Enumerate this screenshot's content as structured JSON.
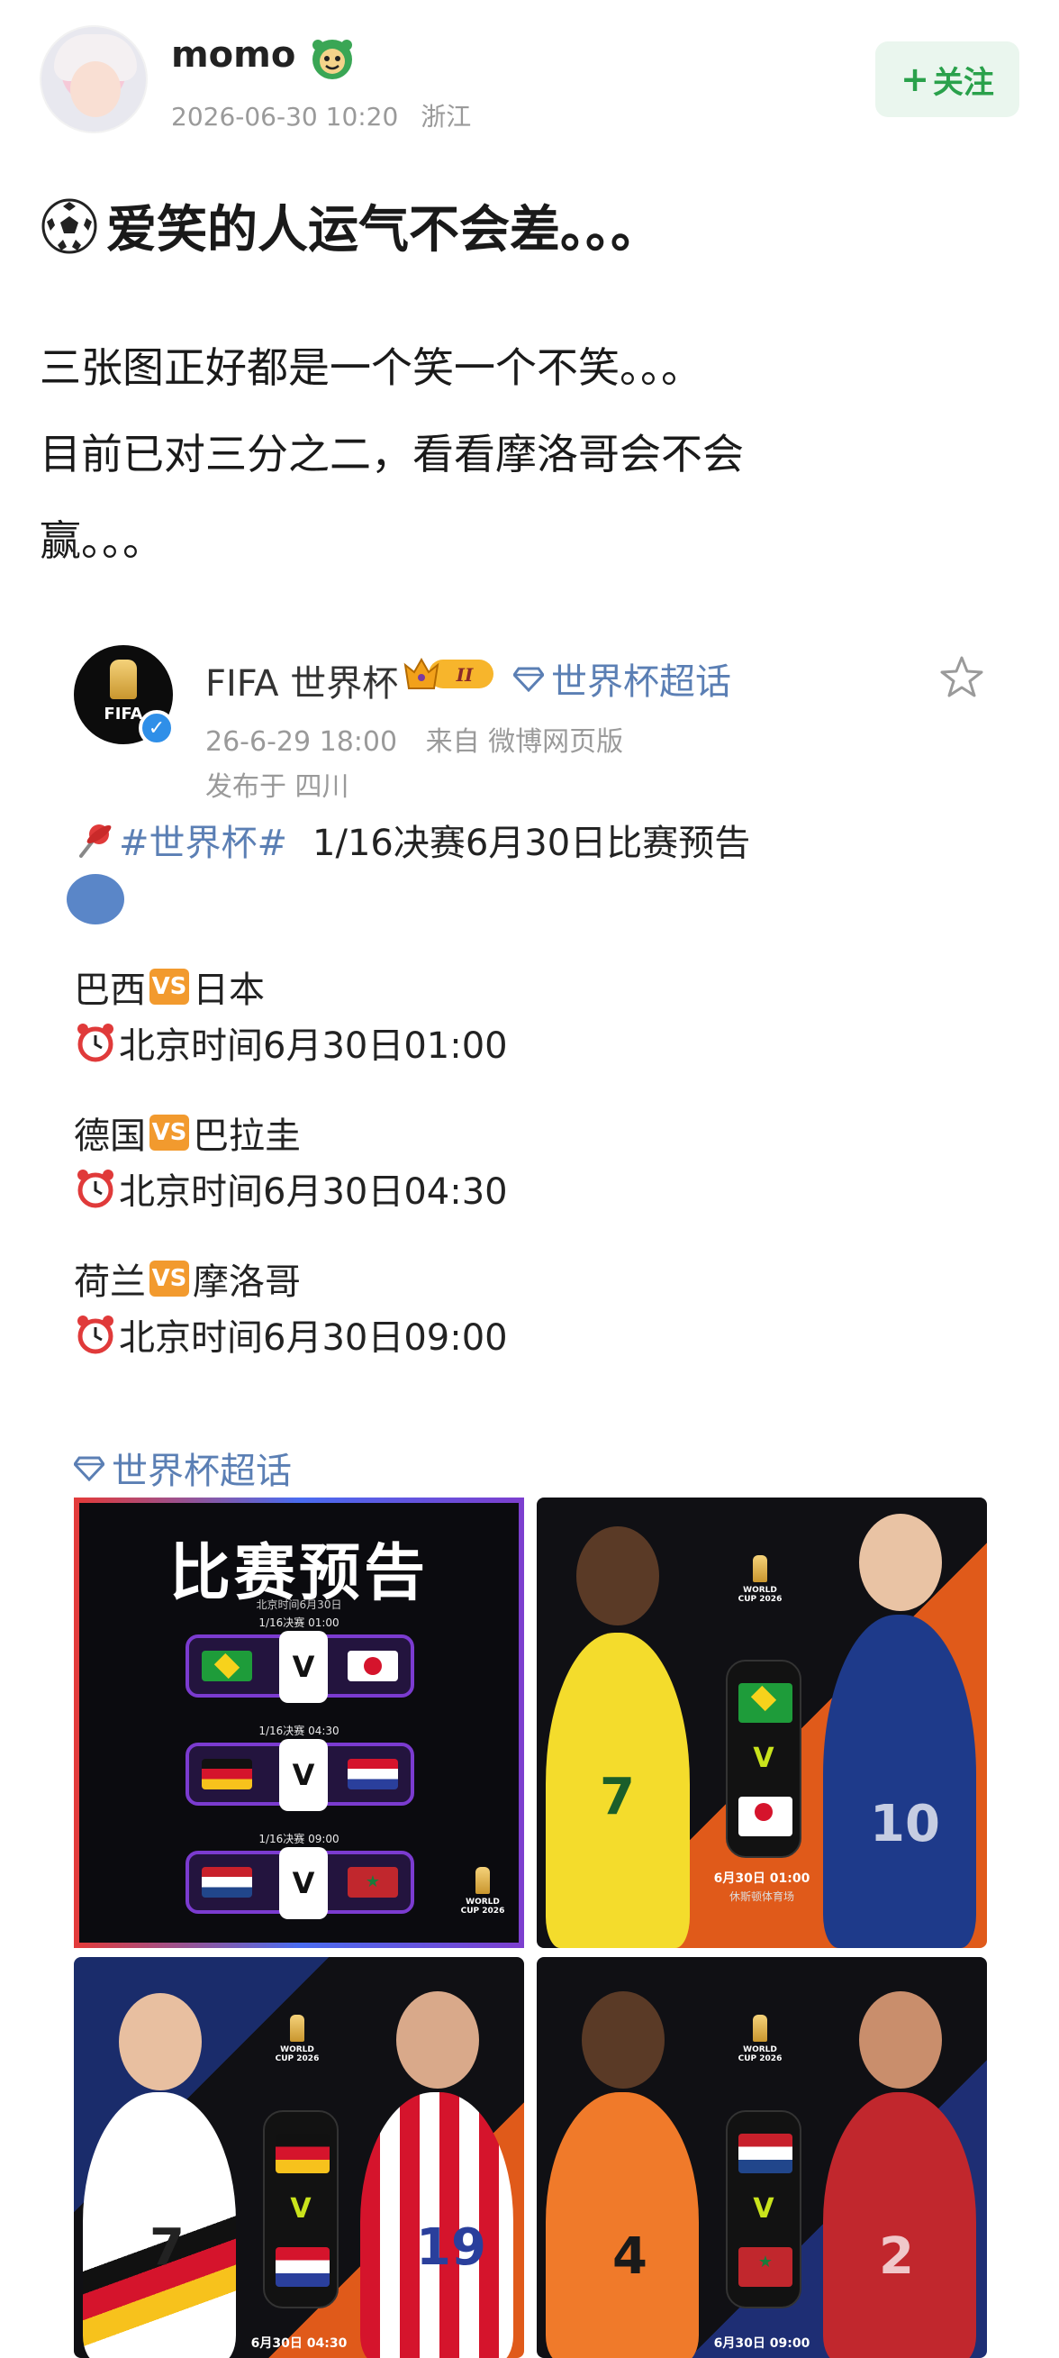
{
  "post": {
    "username": "momo",
    "timestamp": "2026-06-30 10:20",
    "location": "浙江",
    "follow_label": "关注",
    "follow_plus": "+",
    "title": "爱笑的人运气不会差。。。",
    "body_lines": [
      "三张图正好都是一个笑一个不笑。。。",
      "目前已对三分之二，看看摩洛哥会不会",
      "赢。。。"
    ]
  },
  "repost": {
    "author": "FIFA 世界杯",
    "vip_level": "II",
    "supertopic_link": "世界杯超话",
    "date": "26-6-29 18:00",
    "source": "来自 微博网页版",
    "published_in": "发布于 四川",
    "avatar_label": "FIFA",
    "hashtag": "#世界杯#",
    "headline": "1/16决赛6月30日比赛预告",
    "vs_label": "VS",
    "matches": [
      {
        "home": "巴西",
        "away": "日本",
        "time": "北京时间6月30日01:00"
      },
      {
        "home": "德国",
        "away": "巴拉圭",
        "time": "北京时间6月30日04:30"
      },
      {
        "home": "荷兰",
        "away": "摩洛哥",
        "time": "北京时间6月30日09:00"
      }
    ],
    "topic_footer": "世界杯超话",
    "images": {
      "preview": {
        "title": "比赛预告",
        "subtitle": "北京时间6月30日",
        "rows": [
          {
            "label": "1/16决赛 01:00"
          },
          {
            "label": "1/16决赛 04:30"
          },
          {
            "label": "1/16决赛 09:00"
          }
        ]
      },
      "tile2": {
        "caption": "6月30日 01:00",
        "venue": "休斯顿体育场",
        "left_number": "7",
        "right_number": "10"
      },
      "tile3": {
        "caption": "6月30日 04:30",
        "left_number": "7",
        "right_number": "19"
      },
      "tile4": {
        "caption": "6月30日 09:00",
        "left_number": "4",
        "right_number": "2"
      },
      "wc_logo_text": "WORLD CUP 2026"
    }
  },
  "colors": {
    "accent_green": "#2aa14b",
    "link_blue": "#5b7fb4",
    "vs_orange": "#f29a2e",
    "meta_gray": "#9a9a9a"
  }
}
